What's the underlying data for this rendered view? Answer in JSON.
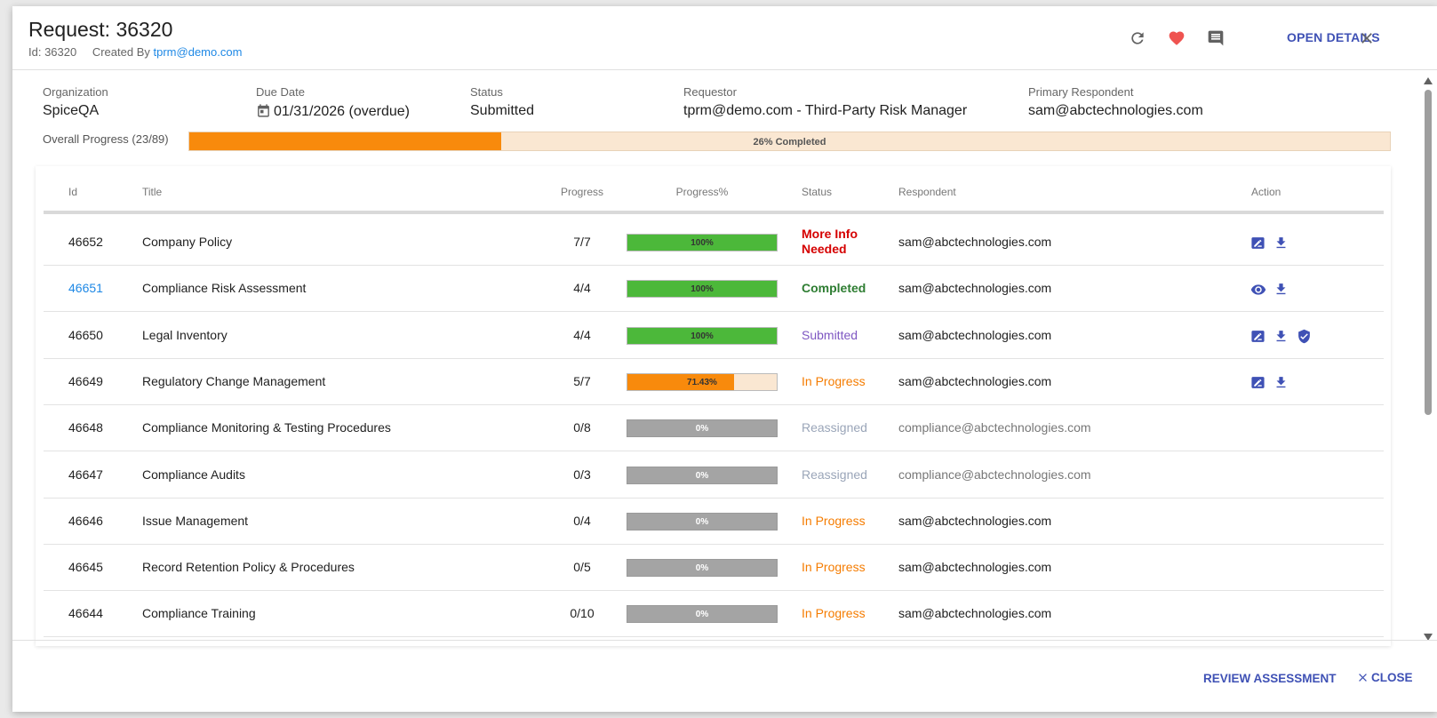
{
  "header": {
    "title": "Request: 36320",
    "id_text": "Id: 36320",
    "created_by_prefix": "Created By",
    "created_by": "tprm@demo.com",
    "open_details": "OPEN DETAILS"
  },
  "info": {
    "organization_label": "Organization",
    "organization": "SpiceQA",
    "due_date_label": "Due Date",
    "due_date": "01/31/2026 (overdue)",
    "status_label": "Status",
    "status": "Submitted",
    "requestor_label": "Requestor",
    "requestor": "tprm@demo.com - Third-Party Risk Manager",
    "primary_respondent_label": "Primary Respondent",
    "primary_respondent": "sam@abctechnologies.com"
  },
  "overall": {
    "label": "Overall Progress  (23/89)",
    "percent": 26,
    "text": "26% Completed"
  },
  "table": {
    "headers": {
      "id": "Id",
      "title": "Title",
      "progress": "Progress",
      "progress_pct": "Progress%",
      "status": "Status",
      "respondent": "Respondent",
      "action": "Action"
    },
    "rows": [
      {
        "id": "46652",
        "title": "Company Policy",
        "progress": "7/7",
        "pct": 100,
        "pct_text": "100%",
        "status_line1": "More Info",
        "status_line2": "Needed",
        "respondent": "sam@abctechnologies.com"
      },
      {
        "id": "46651",
        "title": "Compliance Risk Assessment",
        "progress": "4/4",
        "pct": 100,
        "pct_text": "100%",
        "status_line1": "Completed",
        "status_line2": "",
        "respondent": "sam@abctechnologies.com"
      },
      {
        "id": "46650",
        "title": "Legal Inventory",
        "progress": "4/4",
        "pct": 100,
        "pct_text": "100%",
        "status_line1": "Submitted",
        "status_line2": "",
        "respondent": "sam@abctechnologies.com"
      },
      {
        "id": "46649",
        "title": "Regulatory Change Management",
        "progress": "5/7",
        "pct": 71.43,
        "pct_text": "71.43%",
        "status_line1": "In Progress",
        "status_line2": "",
        "respondent": "sam@abctechnologies.com"
      },
      {
        "id": "46648",
        "title": "Compliance Monitoring & Testing Procedures",
        "progress": "0/8",
        "pct": 0,
        "pct_text": "0%",
        "status_line1": "Reassigned",
        "status_line2": "",
        "respondent": "compliance@abctechnologies.com"
      },
      {
        "id": "46647",
        "title": "Compliance Audits",
        "progress": "0/3",
        "pct": 0,
        "pct_text": "0%",
        "status_line1": "Reassigned",
        "status_line2": "",
        "respondent": "compliance@abctechnologies.com"
      },
      {
        "id": "46646",
        "title": "Issue Management",
        "progress": "0/4",
        "pct": 0,
        "pct_text": "0%",
        "status_line1": "In Progress",
        "status_line2": "",
        "respondent": "sam@abctechnologies.com"
      },
      {
        "id": "46645",
        "title": "Record Retention Policy & Procedures",
        "progress": "0/5",
        "pct": 0,
        "pct_text": "0%",
        "status_line1": "In Progress",
        "status_line2": "",
        "respondent": "sam@abctechnologies.com"
      },
      {
        "id": "46644",
        "title": "Compliance Training",
        "progress": "0/10",
        "pct": 0,
        "pct_text": "0%",
        "status_line1": "In Progress",
        "status_line2": "",
        "respondent": "sam@abctechnologies.com"
      }
    ]
  },
  "footer": {
    "review": "REVIEW ASSESSMENT",
    "close": "CLOSE"
  },
  "colors": {
    "accent": "#3f51b5",
    "link": "#1e88e5",
    "overdue": "#d32f2f",
    "complete_bar": "#4cb83a",
    "progress_bar": "#f88a0c",
    "more_info": "#d50000",
    "completed": "#2e7d32",
    "submitted": "#7e57c2",
    "in_progress": "#f57c00",
    "reassigned": "#9aa5b8",
    "heart": "#ef5350"
  },
  "icons": {
    "refresh": "refresh-icon",
    "favorite": "heart-icon",
    "comments": "comment-icon",
    "close": "close-icon",
    "calendar": "calendar-icon",
    "edit": "edit-note-icon",
    "download": "download-icon",
    "view": "eye-icon",
    "verify": "shield-check-icon"
  }
}
